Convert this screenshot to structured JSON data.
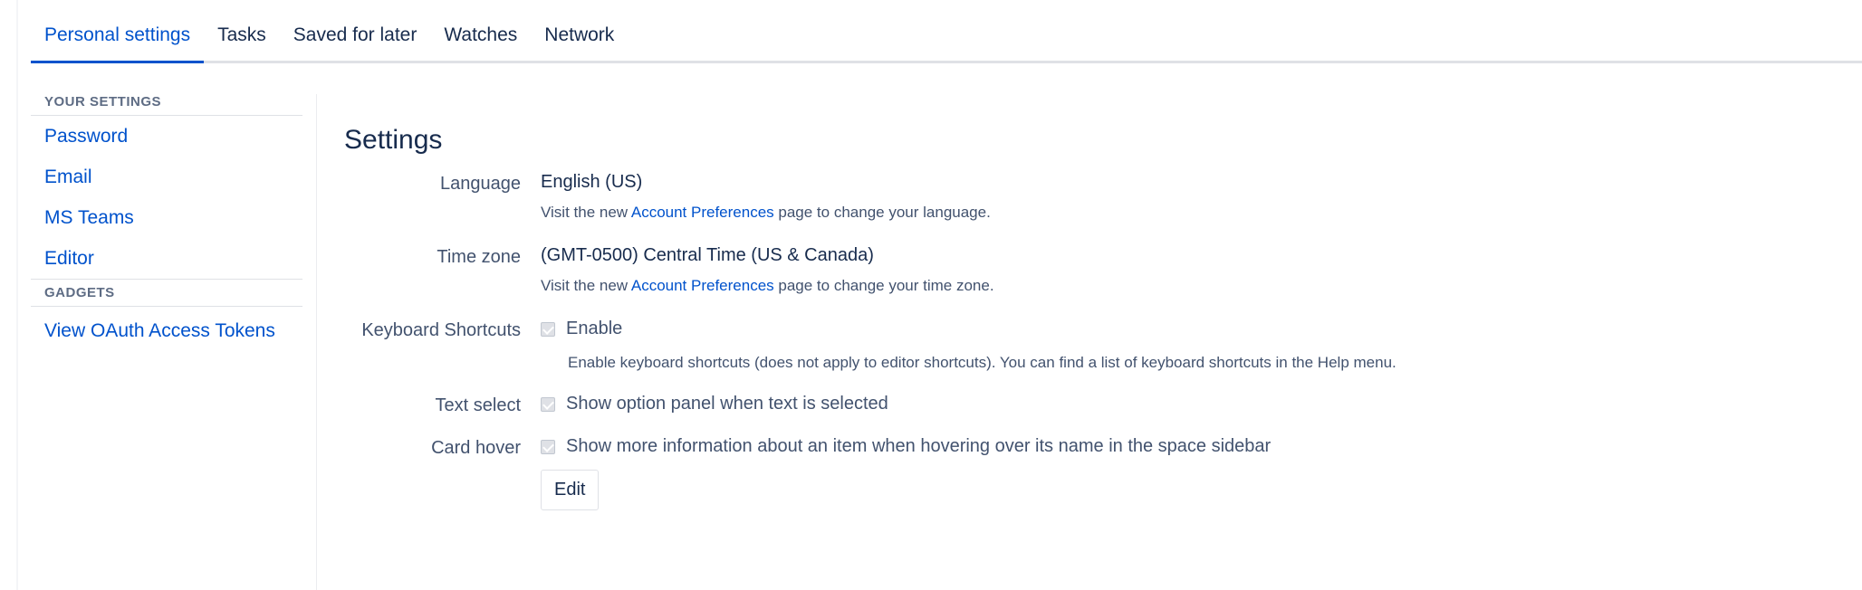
{
  "tabs": [
    {
      "label": "Personal settings",
      "active": true
    },
    {
      "label": "Tasks"
    },
    {
      "label": "Saved for later"
    },
    {
      "label": "Watches"
    },
    {
      "label": "Network"
    }
  ],
  "sidebar": {
    "your_settings_heading": "YOUR SETTINGS",
    "your_settings_items": [
      "Password",
      "Email",
      "MS Teams",
      "Editor"
    ],
    "gadgets_heading": "GADGETS",
    "gadgets_items": [
      "View OAuth Access Tokens"
    ]
  },
  "main": {
    "title": "Settings",
    "language": {
      "label": "Language",
      "value": "English (US)",
      "help_prefix": "Visit the new ",
      "help_link": "Account Preferences",
      "help_suffix": " page to change your language."
    },
    "timezone": {
      "label": "Time zone",
      "value": "(GMT-0500) Central Time (US & Canada)",
      "help_prefix": "Visit the new ",
      "help_link": "Account Preferences",
      "help_suffix": " page to change your time zone."
    },
    "keyboard": {
      "label": "Keyboard Shortcuts",
      "checkbox_label": "Enable",
      "checked": true,
      "help": "Enable keyboard shortcuts (does not apply to editor shortcuts). You can find a list of keyboard shortcuts in the Help menu."
    },
    "text_select": {
      "label": "Text select",
      "checkbox_label": "Show option panel when text is selected",
      "checked": true
    },
    "card_hover": {
      "label": "Card hover",
      "checkbox_label": "Show more information about an item when hovering over its name in the space sidebar",
      "checked": true
    },
    "edit_button": "Edit"
  },
  "colors": {
    "link": "#0052cc",
    "text": "#172b4d",
    "muted": "#42526e",
    "divider": "#dfe1e6"
  }
}
